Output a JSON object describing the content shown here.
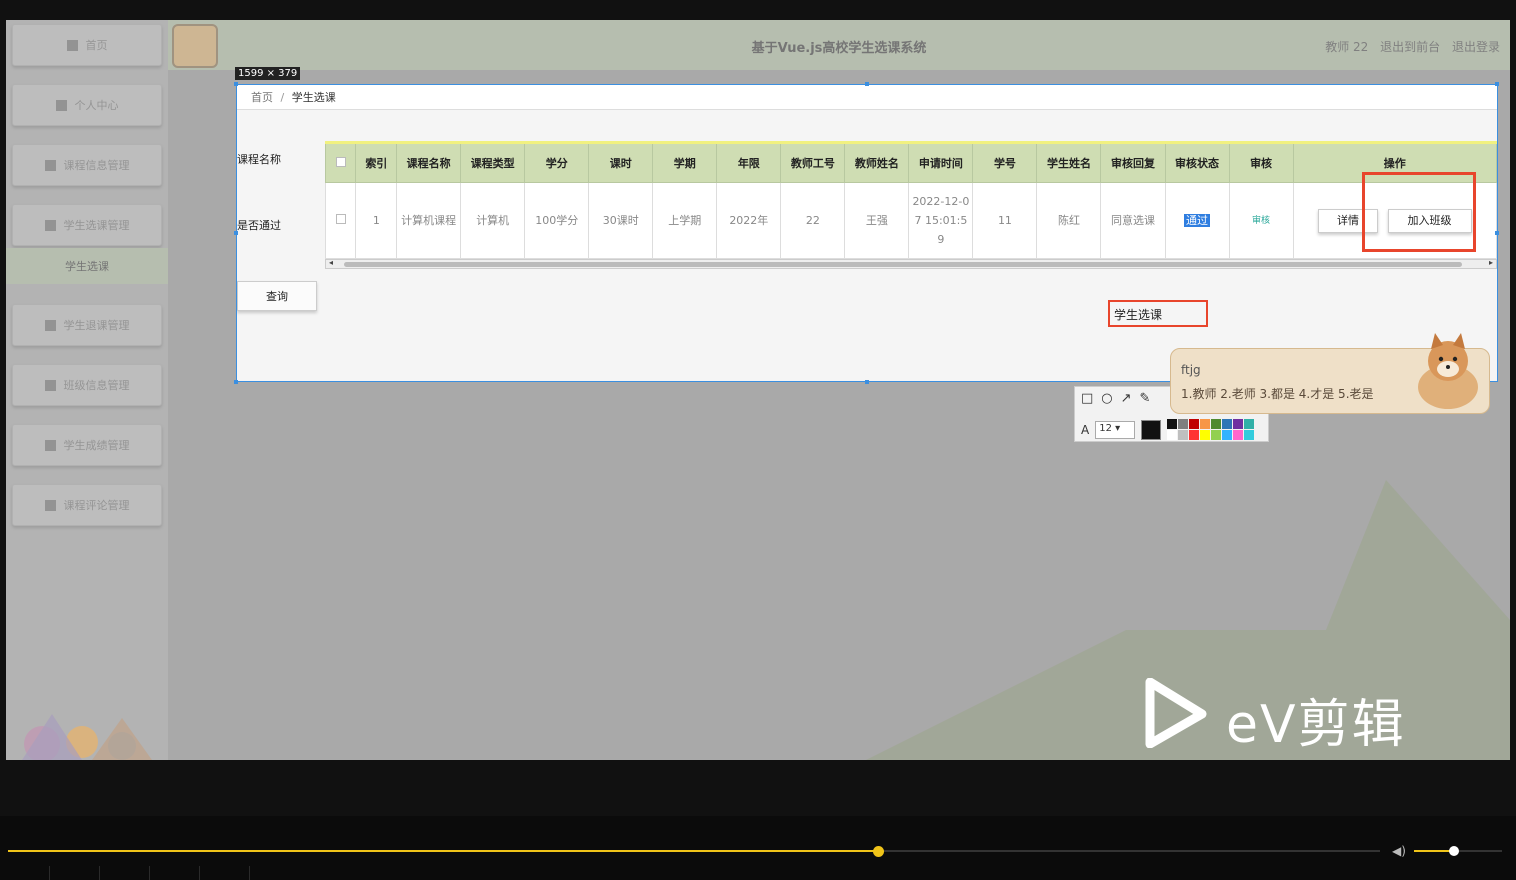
{
  "app": {
    "title": "基于Vue.js高校学生选课系统",
    "user": "教师 22",
    "to_front": "退出到前台",
    "logout": "退出登录"
  },
  "sidebar": {
    "items": [
      {
        "label": "首页",
        "icon": "home-icon"
      },
      {
        "label": "个人中心",
        "icon": "user-icon"
      },
      {
        "label": "课程信息管理",
        "icon": "monitor-icon"
      },
      {
        "label": "学生选课管理",
        "icon": "grid-icon"
      },
      {
        "label": "学生退课管理",
        "icon": "list-icon"
      },
      {
        "label": "班级信息管理",
        "icon": "grid-icon"
      },
      {
        "label": "学生成绩管理",
        "icon": "list-icon"
      },
      {
        "label": "课程评论管理",
        "icon": "user-icon"
      }
    ],
    "active_sub": "学生选课"
  },
  "breadcrumb": {
    "home": "首页",
    "separator": "/",
    "current": "学生选课"
  },
  "search": {
    "course_label": "课程名称",
    "course_placeholder": "课程名称",
    "passed_label": "是否通过",
    "passed_placeholder": "是否通过",
    "query_button": "查询"
  },
  "table": {
    "columns": [
      "索引",
      "课程名称",
      "课程类型",
      "学分",
      "课时",
      "学期",
      "年限",
      "教师工号",
      "教师姓名",
      "申请时间",
      "学号",
      "学生姓名",
      "审核回复",
      "审核状态",
      "审核",
      "操作"
    ],
    "row": {
      "index": "1",
      "course_name": "计算机课程",
      "course_type": "计算机",
      "credit": "100学分",
      "hours": "30课时",
      "term": "上学期",
      "year": "2022年",
      "teacher_id": "22",
      "teacher_name": "王强",
      "apply_time": "2022-12-07 15:01:59",
      "student_id": "11",
      "student_name": "陈红",
      "reply": "同意选课",
      "status": "通过",
      "audit": "审核",
      "detail_button": "详情",
      "join_button": "加入班级"
    }
  },
  "capture": {
    "size_tag": "1599 × 379",
    "text_annotation": "学生选课"
  },
  "capture_toolbar": {
    "tools": [
      "rect-icon",
      "circle-icon",
      "arrow-icon",
      "pen-icon"
    ],
    "font_size": "12",
    "current_color": "#111111",
    "palette": [
      "#111111",
      "#7f7f7f",
      "#c00000",
      "#f79646",
      "#4f8a2f",
      "#2e75b6",
      "#7030a0",
      "#31b0a8",
      "#ffffff",
      "#bfbfbf",
      "#ff3333",
      "#ffff00",
      "#92d050",
      "#33b3ff",
      "#ff66cc",
      "#33ccdd"
    ]
  },
  "ime": {
    "code": "ftjg",
    "candidates": "1.教师  2.老师  3.都是  4.才是  5.老是"
  },
  "watermark": {
    "text": "eV剪辑"
  },
  "player": {
    "progress": 0.634,
    "volume": 0.45
  },
  "colors": {
    "accent_green": "#cfddb3",
    "annotation_red": "#e8452c",
    "selection_blue": "#3b8fe0",
    "progress_yellow": "#f0c419"
  }
}
